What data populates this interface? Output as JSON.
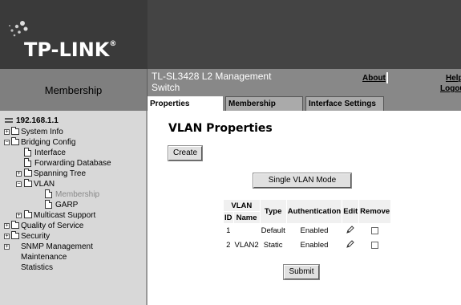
{
  "brand": {
    "logo_text": "TP-LINK",
    "trademark": "®"
  },
  "header": {
    "section_label": "Membership",
    "product_title": "TL-SL3428 L2 Management Switch",
    "about_label": "About",
    "help_label": "Help",
    "logout_label": "Logout"
  },
  "tabs": [
    {
      "label": "Properties",
      "active": true
    },
    {
      "label": "Membership",
      "active": false
    },
    {
      "label": "Interface Settings",
      "active": false
    }
  ],
  "sidebar": {
    "root": "192.168.1.1",
    "items": [
      {
        "label": "System Info"
      },
      {
        "label": "Bridging Config"
      },
      {
        "label": "Interface"
      },
      {
        "label": "Forwarding Database"
      },
      {
        "label": "Spanning Tree"
      },
      {
        "label": "VLAN"
      },
      {
        "label": "Membership",
        "selected": true
      },
      {
        "label": "GARP"
      },
      {
        "label": "Multicast Support"
      },
      {
        "label": "Quality of Service"
      },
      {
        "label": "Security"
      },
      {
        "label": "SNMP Management"
      },
      {
        "label": "Maintenance"
      },
      {
        "label": "Statistics"
      }
    ]
  },
  "main": {
    "title": "VLAN Properties",
    "create_label": "Create",
    "mode_label": "Single VLAN Mode",
    "submit_label": "Submit",
    "table": {
      "headers": {
        "vlan_top": "VLAN",
        "id": "ID",
        "name": "Name",
        "type": "Type",
        "auth": "Authentication",
        "edit": "Edit",
        "remove": "Remove"
      },
      "rows": [
        {
          "id": "1",
          "name": "",
          "type": "Default",
          "auth": "Enabled",
          "removable": false
        },
        {
          "id": "2",
          "name": "VLAN2",
          "type": "Static",
          "auth": "Enabled",
          "removable": false
        }
      ]
    }
  },
  "colors": {
    "header_bg": "#444444",
    "title_band": "#888888",
    "sidebar_bg": "#d8d8d8"
  },
  "icons": [
    "pencil-icon",
    "folder-icon",
    "document-icon",
    "network-root-icon"
  ]
}
